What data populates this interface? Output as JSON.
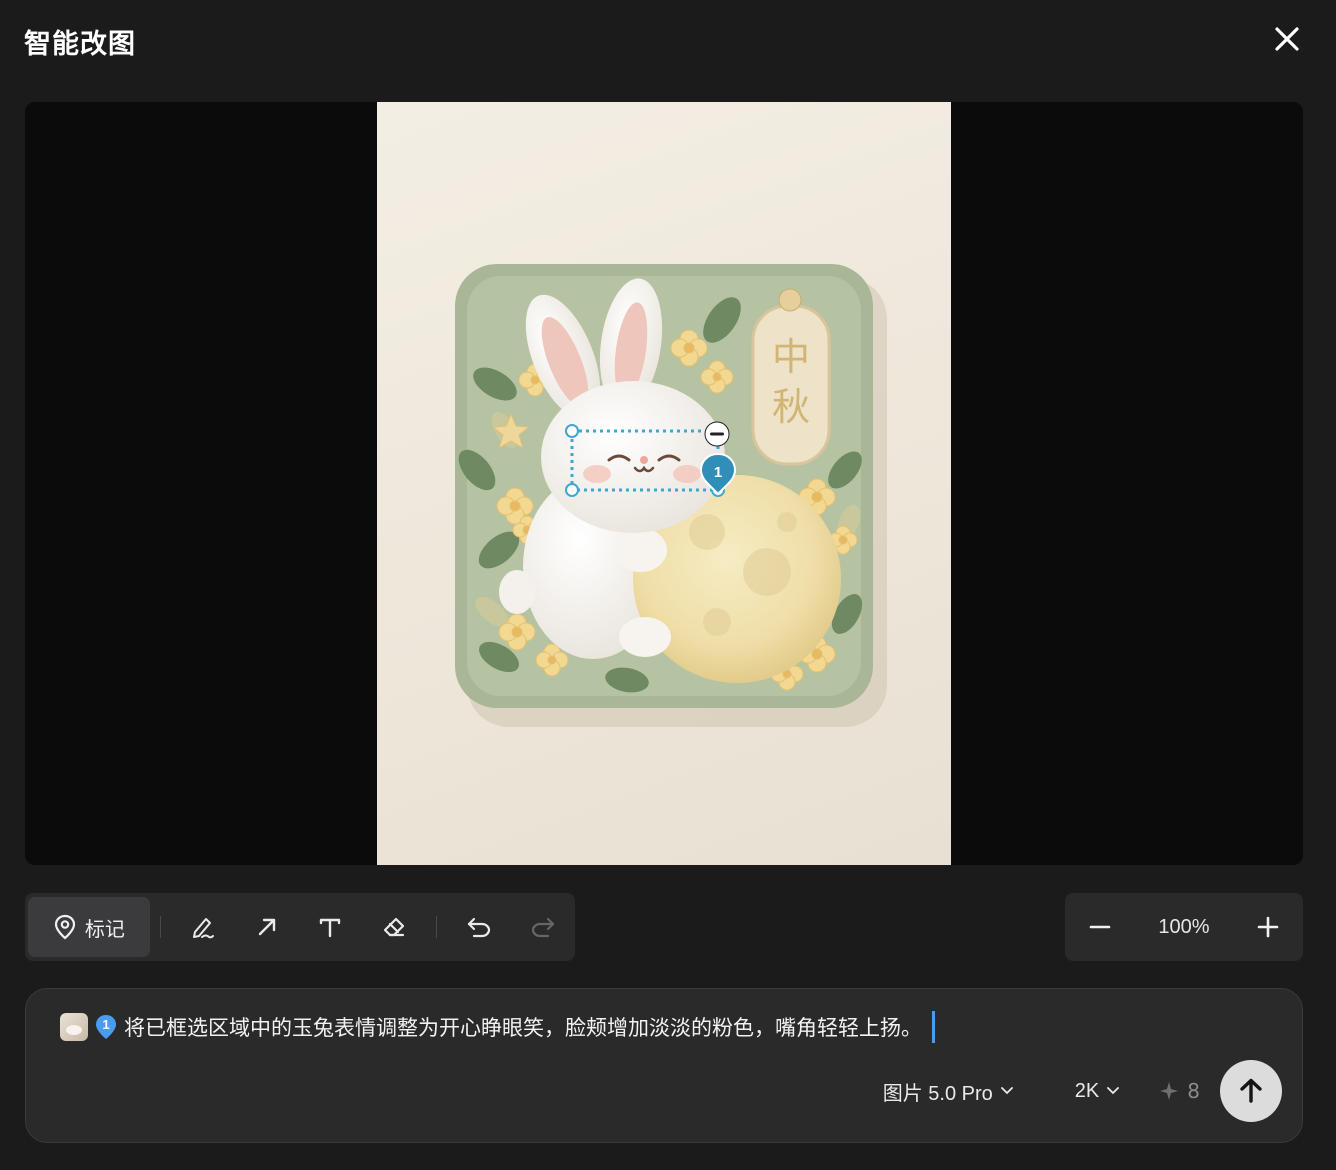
{
  "header": {
    "title": "智能改图",
    "close_icon": "close-icon"
  },
  "canvas": {
    "artwork_text": [
      "中",
      "秋"
    ],
    "marker_number": "1"
  },
  "toolbar": {
    "mark_label": "标记",
    "tools": [
      "pen-icon",
      "arrow-icon",
      "text-icon",
      "eraser-icon",
      "undo-icon",
      "redo-icon"
    ]
  },
  "zoom": {
    "level": "100%"
  },
  "prompt": {
    "marker_number": "1",
    "text": "将已框选区域中的玉兔表情调整为开心睁眼笑，脸颊增加淡淡的粉色，嘴角轻轻上扬。",
    "model": "图片 5.0 Pro",
    "resolution": "2K",
    "credits": "8"
  },
  "colors": {
    "background": "#1b1b1c",
    "panel": "#2a2a2b",
    "accent_blue": "#4a9cf0",
    "marker_teal": "#2f8fb8"
  }
}
